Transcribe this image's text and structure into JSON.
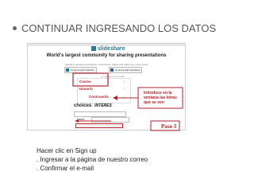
{
  "slide": {
    "heading": "CONTINUAR INGRESANDO LOS DATOS"
  },
  "screenshot": {
    "logo": "slideshare",
    "headline_line1": "World's largest community for sharing presentations",
    "subtext": "Upload & upload presentations, documents, videos and make your voice heard",
    "connect_linkedin": "Connect with LinkedIn",
    "connect_facebook": "Connect with Facebook",
    "or_text": "or register using email",
    "fields": [
      "Correo",
      "Usuario",
      "Contraseña"
    ],
    "captcha_label": "choices",
    "captcha_word": "INTERES",
    "name_label": "Name",
    "note": "Introduce en la ventana las letras que se ven",
    "step": "Paso 3"
  },
  "instructions": {
    "line1": "Hacer clic en Sign up",
    "line2": ". Ingresar a la página de nuestro correo",
    "line3": ". Confirmar el e-mail"
  },
  "colors": {
    "accent_red": "#b0262c",
    "brand": "#2a7a8c"
  }
}
